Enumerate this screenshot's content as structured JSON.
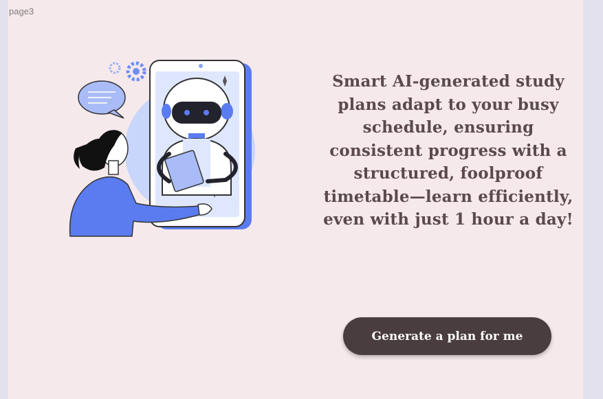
{
  "page": {
    "label": "page3"
  },
  "hero": {
    "tagline": "Smart AI-generated study plans adapt to your busy schedule, ensuring consistent progress with a structured, foolproof timetable—learn efficiently, even with just 1 hour a day!",
    "cta_label": "Generate a plan for me"
  },
  "colors": {
    "page_background": "#f6e9ec",
    "side_background": "#e3e1ee",
    "text": "#5b4a4c",
    "button": "#4a3d3f",
    "illustration_blue": "#5b7cf0"
  },
  "illustration": {
    "icon": "robot-tablet-student-illustration"
  }
}
